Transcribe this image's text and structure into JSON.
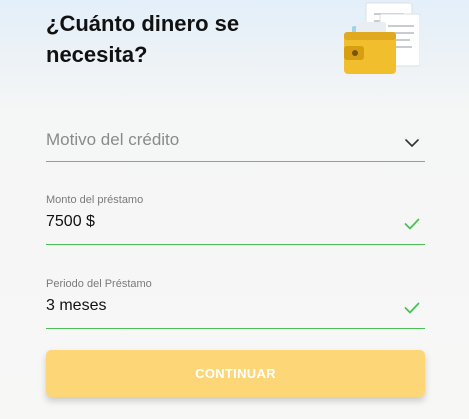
{
  "header": {
    "title": "¿Cuánto dinero se necesita?",
    "illustration_icon": "wallet-documents-icon"
  },
  "form": {
    "reason": {
      "placeholder": "Motivo del crédito",
      "icon": "chevron-down-icon"
    },
    "amount": {
      "label": "Monto del préstamo",
      "value": "7500 $",
      "valid_icon": "checkmark-icon"
    },
    "period": {
      "label": "Periodo del Préstamo",
      "value": "3 meses",
      "valid_icon": "checkmark-icon"
    },
    "continue_label": "CONTINUAR"
  },
  "colors": {
    "accent_button": "#fdd678",
    "valid_green": "#4cbf56",
    "wallet_yellow": "#f1be2e"
  }
}
